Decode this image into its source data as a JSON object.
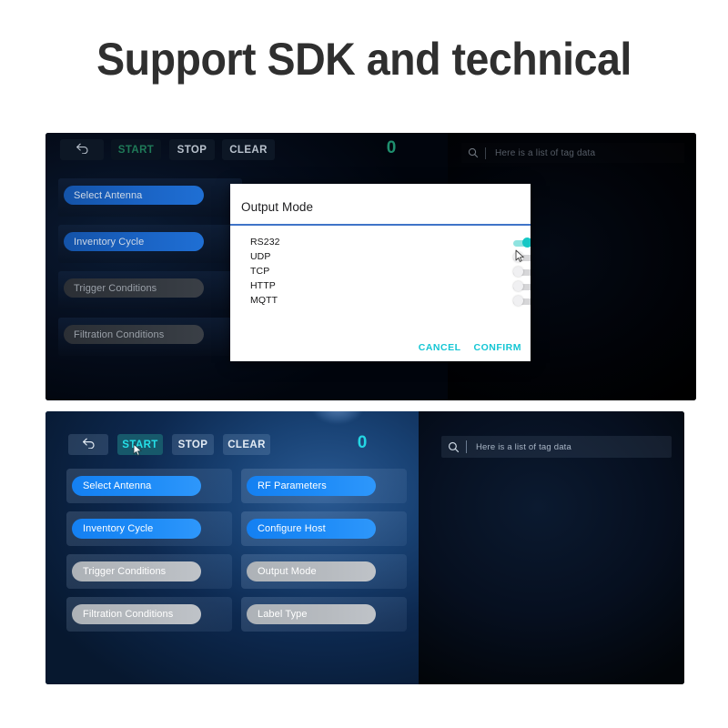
{
  "heading": "Support SDK and technical",
  "top_panel": {
    "toolbar": {
      "back_icon": "back-arrow-icon",
      "start_label": "START",
      "stop_label": "STOP",
      "clear_label": "CLEAR",
      "counter": "0"
    },
    "search": {
      "icon": "search-icon",
      "placeholder": "Here is a list of tag data",
      "value": ""
    },
    "options": [
      {
        "label": "Select Antenna",
        "state": "blue"
      },
      {
        "label": "Inventory Cycle",
        "state": "blue"
      },
      {
        "label": "Trigger Conditions",
        "state": "gray"
      },
      {
        "label": "Filtration Conditions",
        "state": "gray"
      }
    ],
    "dialog": {
      "title": "Output Mode",
      "modes": [
        {
          "label": "RS232",
          "enabled": true
        },
        {
          "label": "UDP",
          "enabled": false
        },
        {
          "label": "TCP",
          "enabled": false
        },
        {
          "label": "HTTP",
          "enabled": false
        },
        {
          "label": "MQTT",
          "enabled": false
        }
      ],
      "cancel_label": "CANCEL",
      "confirm_label": "CONFIRM",
      "accent_color": "#14c6d4",
      "toggle_on_color": "#16c7c5"
    }
  },
  "bottom_panel": {
    "toolbar": {
      "back_icon": "back-arrow-icon",
      "start_label": "START",
      "stop_label": "STOP",
      "clear_label": "CLEAR",
      "counter": "0"
    },
    "search": {
      "icon": "search-icon",
      "placeholder": "Here is a list of tag data",
      "value": ""
    },
    "options_left": [
      {
        "label": "Select Antenna",
        "state": "blue"
      },
      {
        "label": "Inventory Cycle",
        "state": "blue"
      },
      {
        "label": "Trigger Conditions",
        "state": "gray"
      },
      {
        "label": "Filtration Conditions",
        "state": "gray"
      }
    ],
    "options_right": [
      {
        "label": "RF Parameters",
        "state": "blue"
      },
      {
        "label": "Configure Host",
        "state": "blue"
      },
      {
        "label": "Output Mode",
        "state": "gray"
      },
      {
        "label": "Label Type",
        "state": "gray"
      }
    ]
  }
}
